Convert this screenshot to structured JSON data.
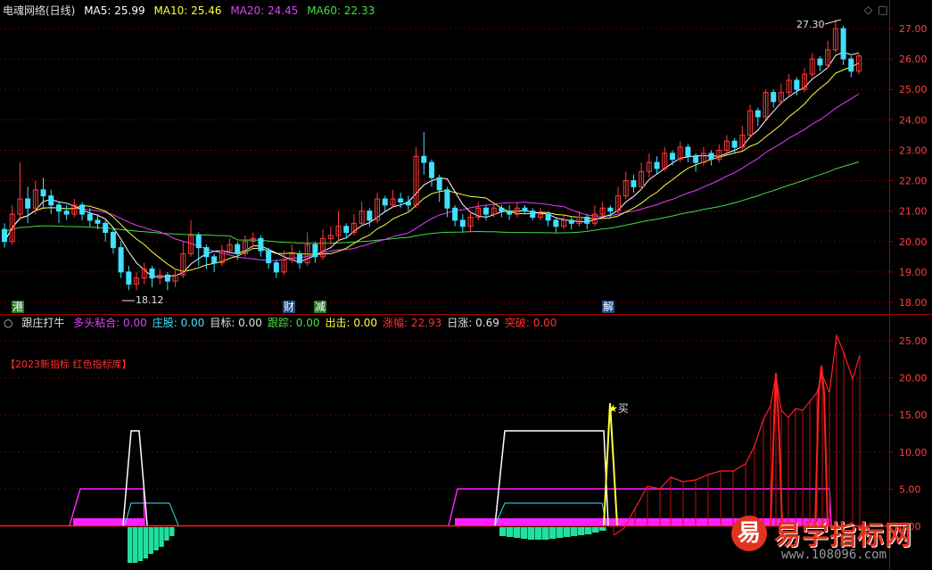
{
  "header": {
    "title": "电魂网络(日线)",
    "ma5": "MA5: 25.99",
    "ma10": "MA10: 25.46",
    "ma20": "MA20: 24.45",
    "ma60": "MA60: 22.33"
  },
  "indicator": {
    "name": "跟庄打牛",
    "items": [
      {
        "label": "多头粘合: 0.00",
        "color": "#e040fb"
      },
      {
        "label": "庄股: 0.00",
        "color": "#40e0ff"
      },
      {
        "label": "目标: 0.00",
        "color": "#e0e0e0"
      },
      {
        "label": "跟踪: 0.00",
        "color": "#40e040"
      },
      {
        "label": "出击: 0.00",
        "color": "#ffff40"
      },
      {
        "label": "涨幅: 22.93",
        "color": "#ff3030"
      },
      {
        "label": "日涨: 0.69",
        "color": "#e0e0e0"
      },
      {
        "label": "突破: 0.00",
        "color": "#ff3030"
      }
    ],
    "banner": "【2023新指标 红色指标库】",
    "buy_label": "买"
  },
  "annotations": {
    "high": "27.30",
    "low": "18.12",
    "marks": [
      "港",
      "财",
      "减",
      "解"
    ]
  },
  "price_axis": [
    "27.00",
    "26.00",
    "25.00",
    "24.00",
    "23.00",
    "22.00",
    "21.00",
    "20.00",
    "19.00",
    "18.00"
  ],
  "ind_axis": [
    "25.00",
    "20.00",
    "15.00",
    "10.00",
    "5.00",
    "0.00"
  ],
  "watermark": {
    "title": "易学指标网",
    "url": "www.108096.com",
    "logo": "易"
  },
  "colors": {
    "up": "#ff3c3c",
    "down": "#40e0ff",
    "ma5": "#ffffff",
    "ma10": "#ffff40",
    "ma20": "#e040fb",
    "ma60": "#40e040"
  },
  "chart_data": {
    "type": "candlestick",
    "ylim": [
      17.8,
      27.5
    ],
    "candles": [
      [
        20.4,
        20.0,
        20.6,
        19.8
      ],
      [
        20.0,
        20.9,
        21.2,
        19.9
      ],
      [
        20.9,
        21.4,
        22.6,
        20.7
      ],
      [
        21.4,
        21.1,
        21.8,
        20.6
      ],
      [
        21.1,
        21.7,
        22.0,
        20.9
      ],
      [
        21.7,
        21.5,
        22.1,
        21.1
      ],
      [
        21.5,
        21.2,
        21.7,
        20.9
      ],
      [
        21.2,
        21.0,
        21.3,
        20.6
      ],
      [
        21.0,
        20.9,
        21.2,
        20.7
      ],
      [
        20.9,
        21.2,
        21.4,
        20.8
      ],
      [
        21.2,
        20.9,
        21.3,
        20.7
      ],
      [
        20.9,
        20.7,
        21.1,
        20.5
      ],
      [
        20.7,
        20.6,
        20.9,
        20.4
      ],
      [
        20.6,
        20.3,
        20.7,
        20.0
      ],
      [
        20.3,
        19.8,
        20.4,
        19.6
      ],
      [
        19.8,
        19.0,
        20.0,
        18.8
      ],
      [
        19.0,
        18.6,
        19.2,
        18.4
      ],
      [
        18.6,
        18.8,
        19.0,
        18.4
      ],
      [
        18.8,
        19.1,
        19.3,
        18.6
      ],
      [
        19.1,
        18.8,
        19.2,
        18.5
      ],
      [
        18.8,
        18.9,
        19.1,
        18.6
      ],
      [
        18.9,
        18.7,
        19.0,
        18.4
      ],
      [
        18.7,
        18.9,
        19.1,
        18.5
      ],
      [
        18.9,
        19.6,
        20.0,
        18.8
      ],
      [
        19.6,
        20.2,
        20.7,
        19.5
      ],
      [
        20.2,
        19.8,
        20.3,
        19.2
      ],
      [
        19.8,
        19.5,
        19.9,
        19.1
      ],
      [
        19.5,
        19.3,
        19.6,
        19.0
      ],
      [
        19.3,
        19.7,
        19.9,
        19.2
      ],
      [
        19.7,
        19.9,
        20.1,
        19.6
      ],
      [
        19.9,
        19.6,
        20.0,
        19.4
      ],
      [
        19.6,
        20.0,
        20.2,
        19.5
      ],
      [
        20.0,
        20.1,
        20.3,
        19.8
      ],
      [
        20.1,
        19.7,
        20.2,
        19.5
      ],
      [
        19.7,
        19.3,
        19.8,
        19.1
      ],
      [
        19.3,
        19.0,
        19.4,
        18.8
      ],
      [
        19.0,
        19.4,
        19.7,
        18.9
      ],
      [
        19.4,
        19.6,
        19.9,
        19.3
      ],
      [
        19.6,
        19.3,
        19.7,
        19.1
      ],
      [
        19.3,
        19.9,
        20.3,
        19.2
      ],
      [
        19.9,
        19.5,
        20.0,
        19.3
      ],
      [
        19.5,
        20.1,
        20.4,
        19.4
      ],
      [
        20.1,
        20.2,
        20.5,
        19.9
      ],
      [
        20.2,
        20.5,
        21.0,
        20.0
      ],
      [
        20.5,
        20.3,
        20.6,
        20.1
      ],
      [
        20.3,
        20.6,
        20.9,
        20.2
      ],
      [
        20.6,
        21.0,
        21.3,
        20.5
      ],
      [
        21.0,
        20.7,
        21.1,
        20.5
      ],
      [
        20.7,
        21.4,
        21.6,
        20.6
      ],
      [
        21.4,
        21.2,
        21.5,
        21.0
      ],
      [
        21.2,
        21.4,
        21.7,
        21.1
      ],
      [
        21.4,
        21.3,
        21.6,
        21.1
      ],
      [
        21.3,
        21.2,
        21.5,
        21.0
      ],
      [
        21.2,
        22.8,
        23.1,
        21.1
      ],
      [
        22.8,
        22.6,
        23.6,
        22.2
      ],
      [
        22.6,
        22.1,
        22.7,
        21.8
      ],
      [
        22.1,
        21.7,
        22.2,
        21.3
      ],
      [
        21.7,
        21.1,
        21.8,
        20.8
      ],
      [
        21.1,
        20.7,
        21.2,
        20.5
      ],
      [
        20.7,
        20.5,
        20.9,
        20.3
      ],
      [
        20.5,
        20.8,
        21.0,
        20.3
      ],
      [
        20.8,
        21.1,
        21.3,
        20.7
      ],
      [
        21.1,
        20.9,
        21.2,
        20.7
      ],
      [
        20.9,
        21.1,
        21.3,
        20.8
      ],
      [
        21.1,
        21.0,
        21.2,
        20.8
      ],
      [
        21.0,
        20.9,
        21.2,
        20.7
      ],
      [
        20.9,
        21.1,
        21.3,
        20.8
      ],
      [
        21.1,
        21.0,
        21.2,
        20.9
      ],
      [
        21.0,
        20.8,
        21.1,
        20.7
      ],
      [
        20.8,
        20.9,
        21.1,
        20.7
      ],
      [
        20.9,
        20.7,
        21.0,
        20.5
      ],
      [
        20.7,
        20.5,
        20.8,
        20.3
      ],
      [
        20.5,
        20.7,
        20.9,
        20.4
      ],
      [
        20.7,
        20.6,
        20.8,
        20.4
      ],
      [
        20.6,
        20.8,
        21.0,
        20.5
      ],
      [
        20.8,
        20.6,
        20.9,
        20.4
      ],
      [
        20.6,
        20.9,
        21.2,
        20.5
      ],
      [
        20.9,
        21.1,
        21.3,
        20.8
      ],
      [
        21.1,
        21.0,
        21.2,
        20.8
      ],
      [
        21.0,
        21.5,
        21.8,
        20.9
      ],
      [
        21.5,
        22.0,
        22.3,
        21.4
      ],
      [
        22.0,
        21.8,
        22.2,
        21.6
      ],
      [
        21.8,
        22.3,
        22.6,
        21.7
      ],
      [
        22.3,
        22.6,
        22.9,
        22.1
      ],
      [
        22.6,
        22.4,
        22.8,
        22.2
      ],
      [
        22.4,
        22.9,
        23.1,
        22.3
      ],
      [
        22.9,
        22.7,
        23.0,
        22.5
      ],
      [
        22.7,
        23.1,
        23.3,
        22.6
      ],
      [
        23.1,
        22.8,
        23.2,
        22.6
      ],
      [
        22.8,
        22.6,
        22.9,
        22.3
      ],
      [
        22.6,
        22.9,
        23.1,
        22.5
      ],
      [
        22.9,
        22.7,
        23.0,
        22.5
      ],
      [
        22.7,
        23.0,
        23.2,
        22.6
      ],
      [
        23.0,
        23.3,
        23.5,
        22.9
      ],
      [
        23.3,
        23.1,
        23.4,
        22.9
      ],
      [
        23.1,
        23.5,
        23.8,
        23.0
      ],
      [
        23.5,
        24.3,
        24.5,
        23.4
      ],
      [
        24.3,
        24.1,
        24.4,
        23.8
      ],
      [
        24.1,
        24.9,
        25.0,
        24.0
      ],
      [
        24.9,
        24.6,
        25.0,
        24.4
      ],
      [
        24.6,
        24.9,
        25.2,
        24.5
      ],
      [
        24.9,
        25.3,
        25.5,
        24.8
      ],
      [
        25.3,
        25.0,
        25.4,
        24.8
      ],
      [
        25.0,
        25.5,
        25.7,
        24.9
      ],
      [
        25.5,
        26.0,
        26.2,
        25.4
      ],
      [
        26.0,
        25.8,
        26.1,
        25.6
      ],
      [
        25.8,
        26.3,
        26.6,
        25.7
      ],
      [
        26.3,
        27.0,
        27.3,
        26.2
      ],
      [
        27.0,
        26.0,
        27.1,
        25.8
      ],
      [
        26.0,
        25.6,
        26.1,
        25.4
      ],
      [
        25.6,
        26.1,
        26.2,
        25.5
      ]
    ]
  }
}
